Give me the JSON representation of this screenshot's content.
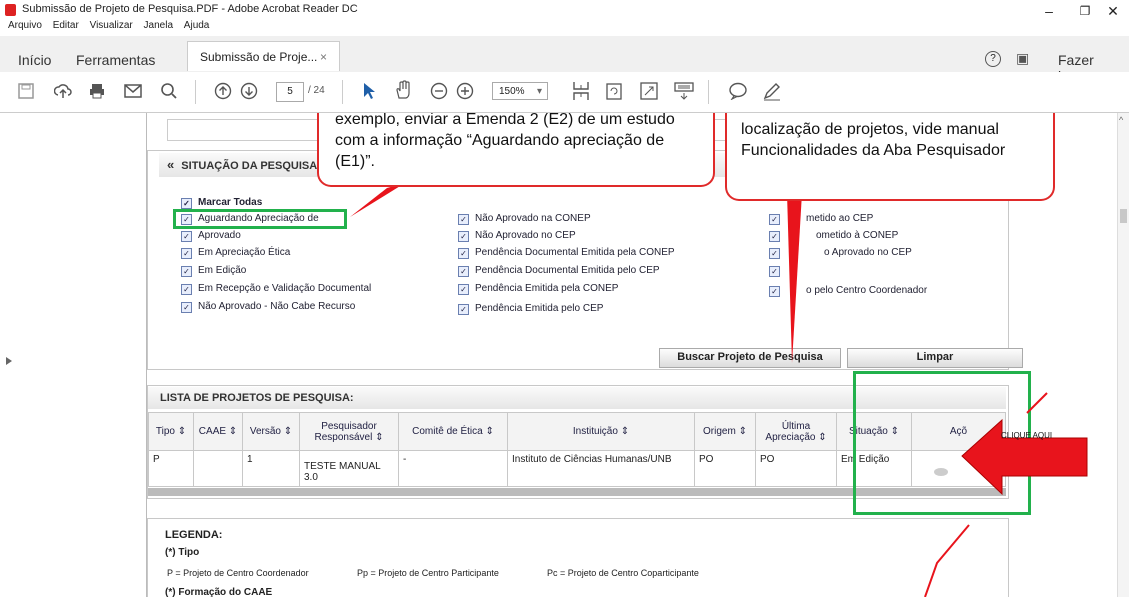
{
  "window": {
    "title": "Submissão de Projeto de Pesquisa.PDF - Adobe Acrobat Reader DC",
    "minimize": "–",
    "restore": "❐",
    "close": "✕"
  },
  "menu": [
    "Arquivo",
    "Editar",
    "Visualizar",
    "Janela",
    "Ajuda"
  ],
  "tabs": {
    "home": "Início",
    "tools": "Ferramentas",
    "document": "Submissão de Proje...",
    "document_close": "×",
    "logout": "Fazer logon",
    "help": "?",
    "mobile": "▣"
  },
  "toolbar": {
    "page_current": "5",
    "page_total": "/ 24",
    "zoom": "150%",
    "zoom_arrow": "▾"
  },
  "callouts": {
    "left": "exemplo, enviar a Emenda 2 (E2) de um estudo com a informação “Aguardando apreciação de (E1)”.",
    "right": "localização de projetos, vide manual Funcionalidades da Aba Pesquisador"
  },
  "situacao": {
    "title": "SITUAÇÃO DA PESQUISA",
    "collapse": "«",
    "col1": [
      "Marcar Todas",
      "Aguardando Apreciação de",
      "Aprovado",
      "Em Apreciação Ética",
      "Em Edição",
      "Em Recepção e Validação Documental",
      "Não Aprovado - Não Cabe Recurso"
    ],
    "col2": [
      "Não Aprovado na CONEP",
      "Não Aprovado no CEP",
      "Pendência Documental Emitida pela CONEP",
      "Pendência Documental Emitida pelo CEP",
      "Pendência Emitida pela CONEP",
      "Pendência Emitida pelo CEP"
    ],
    "col3": [
      "metido ao CEP",
      "ometido à CONEP",
      "o Aprovado no CEP",
      "",
      "o pelo Centro Coordenador"
    ],
    "check": "✓"
  },
  "buttons": {
    "search": "Buscar Projeto de Pesquisa",
    "clear": "Limpar"
  },
  "list": {
    "title": "LISTA DE PROJETOS DE PESQUISA:",
    "headers": [
      "Tipo ⇕",
      "CAAE ⇕",
      "Versão ⇕",
      "Pesquisador Responsável ⇕",
      "Comitê de Ética ⇕",
      "Instituição ⇕",
      "Origem ⇕",
      "Última Apreciação ⇕",
      "Situação ⇕",
      "Açõ"
    ],
    "row": [
      "P",
      "",
      "1",
      "TESTE MANUAL 3.0",
      "-",
      "Instituto de Ciências Humanas/UNB",
      "PO",
      "PO",
      "Em Edição",
      ""
    ]
  },
  "arrow_label": "CLIQUE AQUI",
  "legend": {
    "title": "LEGENDA:",
    "tipo_title": "(*) Tipo",
    "tipo_items": [
      "P  =  Projeto de Centro Coordenador",
      "Pp = Projeto de Centro Participante",
      "Pc = Projeto de Centro Coparticipante"
    ],
    "caae_title": "(*) Formação do CAAE"
  },
  "colors": {
    "callout_border": "#e02a2a",
    "highlight": "#22b14c",
    "arrow": "#e8141c"
  }
}
